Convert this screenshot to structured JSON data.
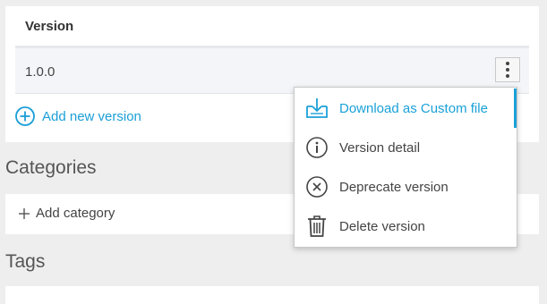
{
  "versions": {
    "header": "Version",
    "rows": [
      {
        "version": "1.0.0"
      }
    ],
    "add_label": "Add new version"
  },
  "context_menu": {
    "items": [
      {
        "label": "Download as Custom file",
        "icon": "download-icon"
      },
      {
        "label": "Version detail",
        "icon": "info-icon"
      },
      {
        "label": "Deprecate version",
        "icon": "deprecate-icon"
      },
      {
        "label": "Delete version",
        "icon": "trash-icon"
      }
    ]
  },
  "categories": {
    "title": "Categories",
    "add_label": "Add category"
  },
  "tags": {
    "title": "Tags"
  },
  "colors": {
    "accent": "#1ba1d8",
    "background": "#eeeeee"
  }
}
